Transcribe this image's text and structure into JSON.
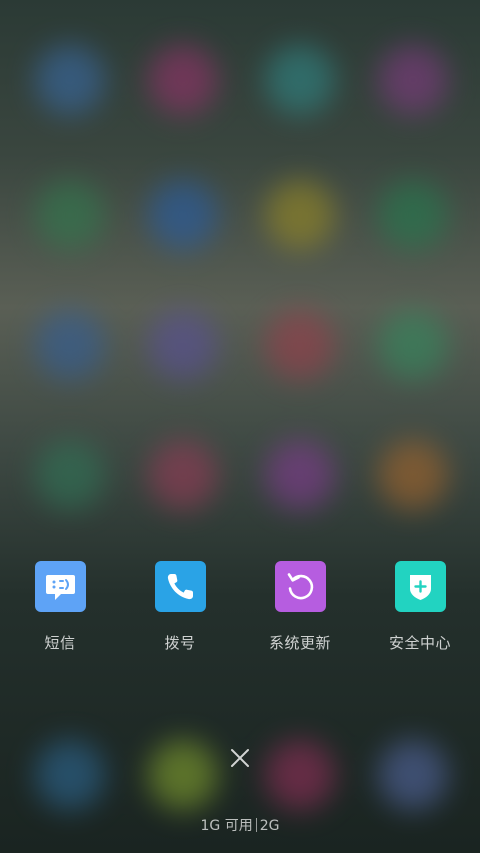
{
  "shortcuts": [
    {
      "label": "短信",
      "icon": "message-icon",
      "color": "#5ea3f6"
    },
    {
      "label": "拨号",
      "icon": "phone-icon",
      "color": "#2aa3e6"
    },
    {
      "label": "系统更新",
      "icon": "refresh-icon",
      "color": "#b65de0"
    },
    {
      "label": "安全中心",
      "icon": "shield-icon",
      "color": "#22d3c1"
    }
  ],
  "memory": {
    "free": "1G 可用",
    "total": "2G"
  }
}
